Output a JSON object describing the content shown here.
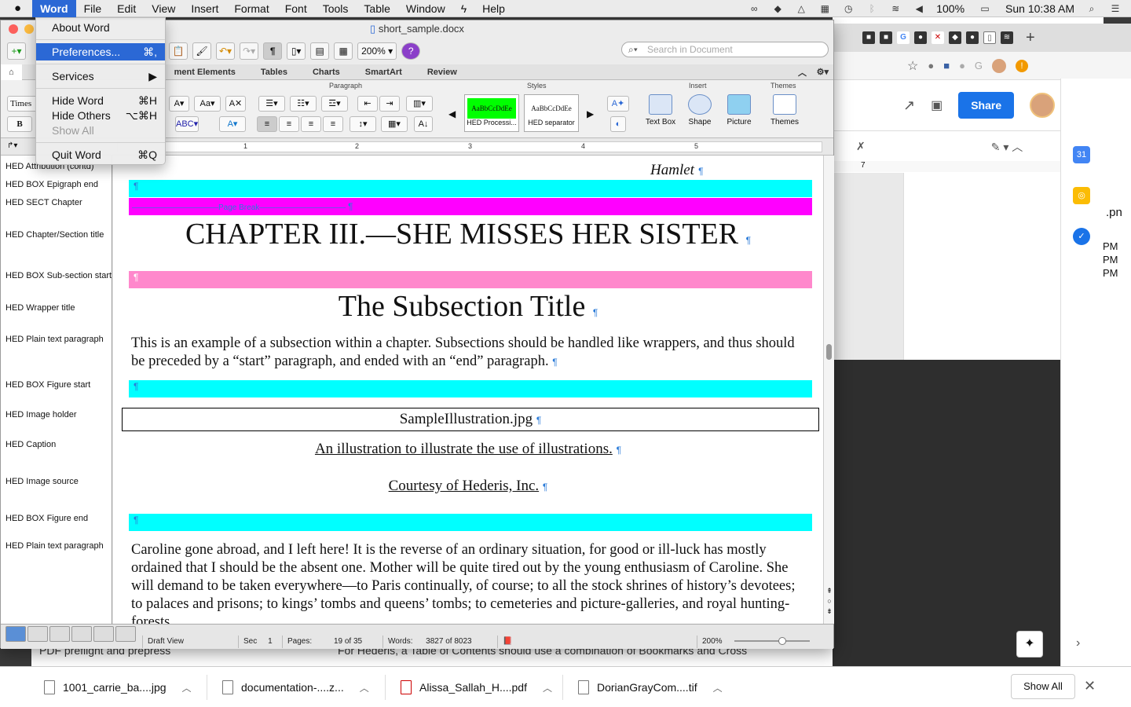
{
  "menubar": {
    "items": [
      "Word",
      "File",
      "Edit",
      "View",
      "Insert",
      "Format",
      "Font",
      "Tools",
      "Table",
      "Window",
      "Help"
    ],
    "battery": "100%",
    "clock": "Sun 10:38 AM"
  },
  "app_menu": {
    "about": "About Word",
    "preferences": "Preferences...",
    "preferences_sc": "⌘,",
    "services": "Services",
    "hide_word": "Hide Word",
    "hide_word_sc": "⌘H",
    "hide_others": "Hide Others",
    "hide_others_sc": "⌥⌘H",
    "show_all": "Show All",
    "quit": "Quit Word",
    "quit_sc": "⌘Q"
  },
  "word": {
    "title": "short_sample.docx",
    "zoom": "200%",
    "search_placeholder": "Search in Document",
    "ribbon_tabs": [
      "ment Elements",
      "Tables",
      "Charts",
      "SmartArt",
      "Review"
    ],
    "groups": {
      "paragraph": "Paragraph",
      "styles": "Styles",
      "insert": "Insert",
      "themes": "Themes"
    },
    "font_name": "Times",
    "style1_swatch": "AaBbCcDdEe",
    "style1_name": "HED Processi...",
    "style2_swatch": "AaBbCcDdEe",
    "style2_name": "HED separator",
    "insert_buttons": [
      "Text Box",
      "Shape",
      "Picture"
    ],
    "themes_button": "Themes",
    "ruler_numbers": [
      "1",
      "2",
      "3",
      "4",
      "5"
    ]
  },
  "style_area": [
    "HED Attribution (contd)",
    "HED BOX Epigraph end",
    "HED SECT Chapter",
    "HED Chapter/Section title",
    "HED BOX Sub-section start",
    "HED Wrapper title",
    "HED Plain text paragraph",
    "HED BOX Figure start",
    "HED Image holder",
    "HED Caption",
    "HED Image source",
    "HED BOX Figure end",
    "HED Plain text paragraph"
  ],
  "document": {
    "attribution": "Hamlet",
    "pilcrow": "¶",
    "page_break": "Page Break",
    "chapter_title": "CHAPTER III.—SHE MISSES HER SISTER",
    "subsection_title": "The Subsection Title",
    "para1": "This is an example of a subsection within a chapter. Subsections should be handled like wrappers, and thus should be preceded by a “start” paragraph, and ended with an “end” paragraph.",
    "image_name": "SampleIllustration.jpg",
    "caption": "An illustration to illustrate the use of illustrations.",
    "source": "Courtesy of Hederis, Inc.",
    "para2": "Caroline gone abroad, and I left here! It is the reverse of an ordinary situation, for good or ill-luck has mostly ordained that I should be the absent one. Mother will be quite tired out by the young enthusiasm of Caroline. She will demand to be taken everywhere—to Paris continually, of course; to all the stock shrines of history’s devotees; to palaces and prisons; to kings’ tombs and queens’ tombs; to cemeteries and picture-galleries, and royal hunting-forests."
  },
  "status": {
    "view": "Draft View",
    "sec_label": "Sec",
    "sec": "1",
    "pages_label": "Pages:",
    "pages": "19 of 35",
    "words_label": "Words:",
    "words": "3827 of 8023",
    "zoom": "200%"
  },
  "chrome": {
    "share": "Share",
    "times": [
      "PM",
      "PM",
      "PM"
    ],
    "ext_fragment": ".pn",
    "ruler_mark": "7"
  },
  "behind": {
    "left_text": "PDF preflight and prepress",
    "right_text": "For Hederis, a Table of Contents should use a combination of Bookmarks and Cross"
  },
  "downloads": {
    "items": [
      "1001_carrie_ba....jpg",
      "documentation-....z...",
      "Alissa_Sallah_H....pdf",
      "DorianGrayCom....tif"
    ],
    "show_all": "Show All"
  },
  "colors": {
    "accent": "#2b68d5",
    "cyan": "#00ffff",
    "magenta": "#ff00ff",
    "pink": "#ff88cc",
    "share": "#1a73e8"
  }
}
